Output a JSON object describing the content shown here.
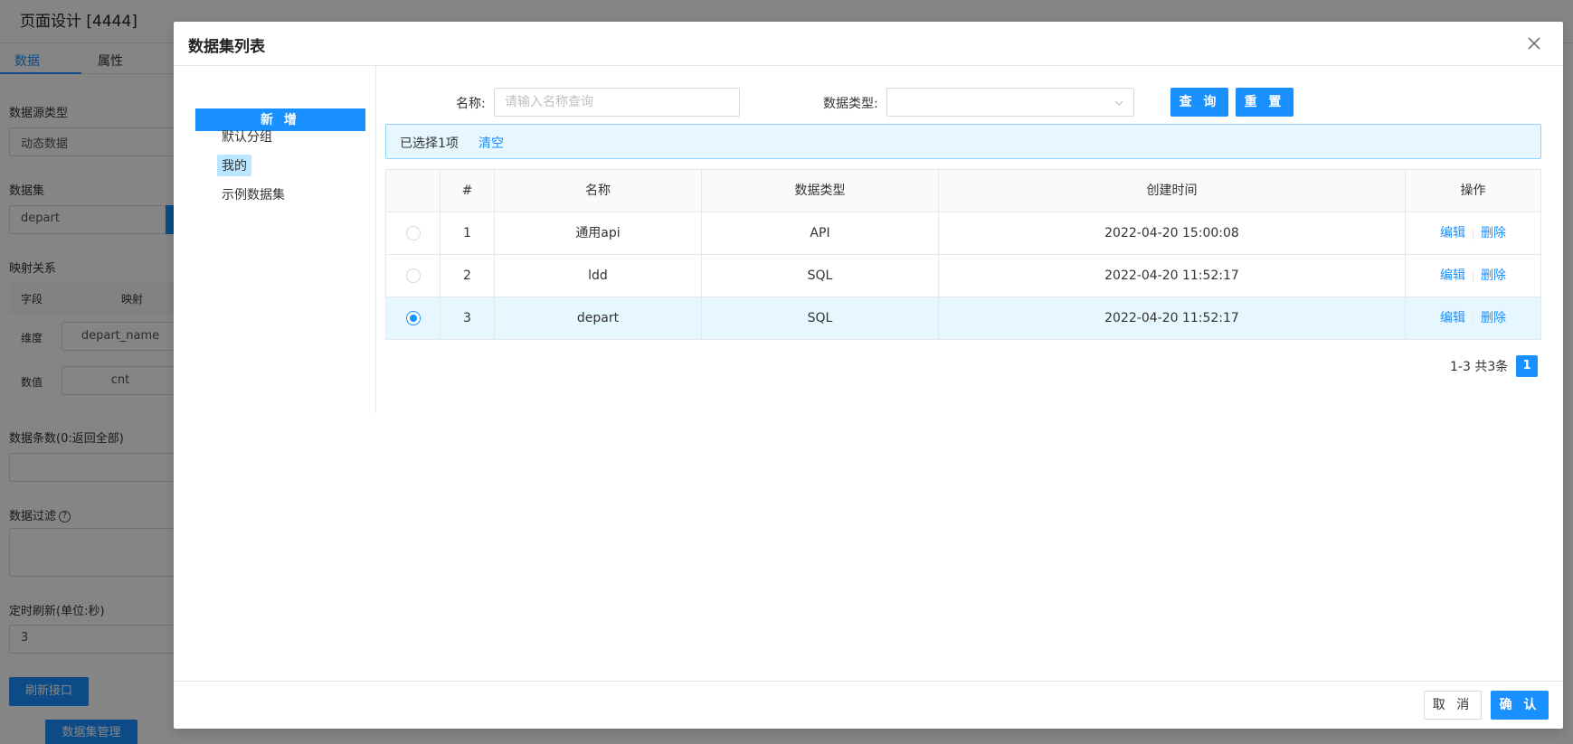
{
  "background": {
    "page_title": "页面设计 [4444]",
    "tabs": [
      "数据",
      "属性"
    ],
    "datasource_type_label": "数据源类型",
    "datasource_type_value": "动态数据",
    "dataset_label": "数据集",
    "dataset_value": "depart",
    "mapping_label": "映射关系",
    "mapping_col_field": "字段",
    "mapping_col_map": "映射",
    "mapping_rows": [
      {
        "field": "维度",
        "value": "depart_name"
      },
      {
        "field": "数值",
        "value": "cnt"
      }
    ],
    "count_label": "数据条数(0:返回全部)",
    "filter_label": "数据过滤",
    "refresh_label": "定时刷新(单位:秒)",
    "refresh_value": "3",
    "refresh_btn": "刷新接口",
    "manage_btn": "数据集管理"
  },
  "modal": {
    "title": "数据集列表",
    "add_btn": "新 增",
    "groups": [
      {
        "label": "默认分组",
        "selected": false
      },
      {
        "label": "我的",
        "selected": true
      },
      {
        "label": "示例数据集",
        "selected": false
      }
    ],
    "search": {
      "name_label": "名称",
      "name_placeholder": "请输入名称查询",
      "type_label": "数据类型",
      "query_btn": "查 询",
      "reset_btn": "重 置"
    },
    "alert": {
      "text": "已选择1项",
      "clear": "清空"
    },
    "table": {
      "headers": [
        "",
        "#",
        "名称",
        "数据类型",
        "创建时间",
        "操作"
      ],
      "rows": [
        {
          "index": "1",
          "name": "通用api",
          "type": "API",
          "created": "2022-04-20 15:00:08",
          "edit": "编辑",
          "delete": "删除",
          "selected": false
        },
        {
          "index": "2",
          "name": "ldd",
          "type": "SQL",
          "created": "2022-04-20 11:52:17",
          "edit": "编辑",
          "delete": "删除",
          "selected": false
        },
        {
          "index": "3",
          "name": "depart",
          "type": "SQL",
          "created": "2022-04-20 11:52:17",
          "edit": "编辑",
          "delete": "删除",
          "selected": true
        }
      ]
    },
    "pagination": {
      "total": "1-3 共3条",
      "current_page": "1"
    },
    "footer": {
      "cancel": "取 消",
      "ok": "确 认"
    }
  },
  "colors": {
    "primary": "#1890ff",
    "selected_row": "#e6f7ff",
    "alert_bg": "#e6f7ff"
  }
}
